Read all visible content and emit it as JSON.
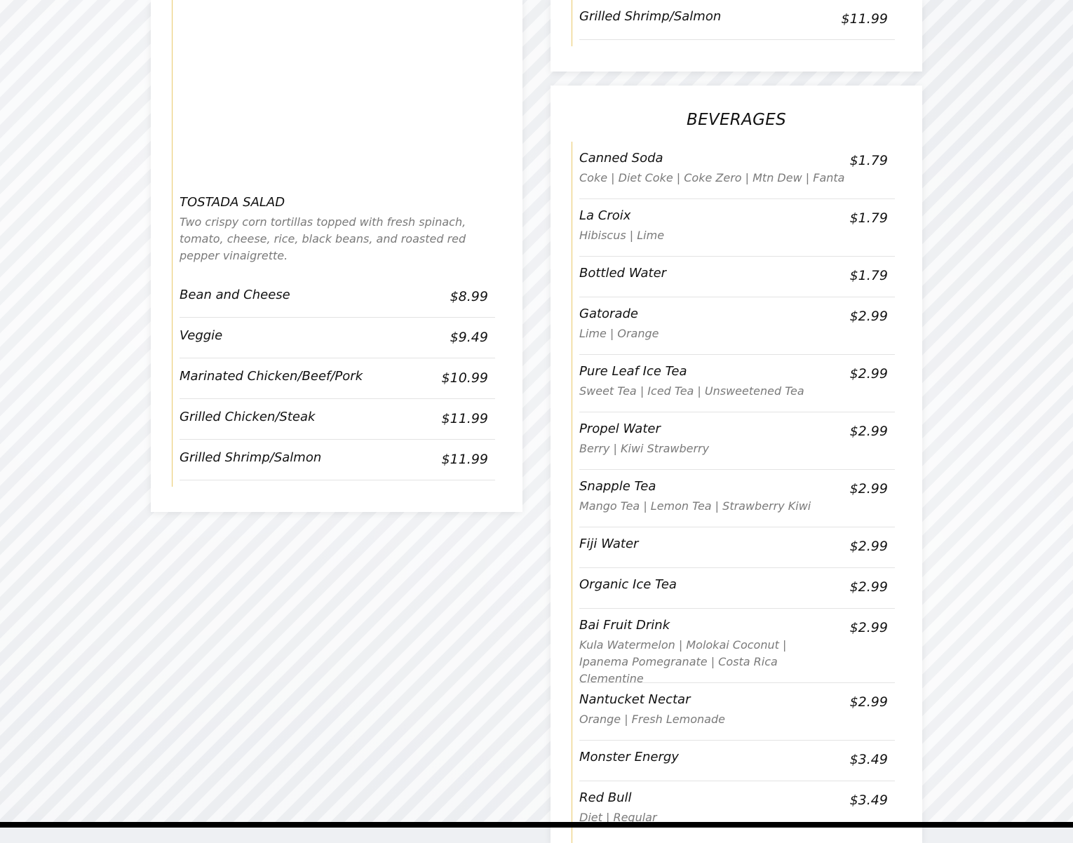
{
  "left_card": {
    "tostada": {
      "title": "TOSTADA SALAD",
      "description": "Two crispy corn tortillas topped with fresh spinach, tomato, cheese, rice, black beans, and roasted red pepper vinaigrette."
    },
    "items": [
      {
        "name": "Bean and Cheese",
        "price": "$8.99"
      },
      {
        "name": "Veggie",
        "price": "$9.49"
      },
      {
        "name": "Marinated Chicken/Beef/Pork",
        "price": "$10.99"
      },
      {
        "name": "Grilled Chicken/Steak",
        "price": "$11.99"
      },
      {
        "name": "Grilled Shrimp/Salmon",
        "price": "$11.99"
      }
    ]
  },
  "right_top_card": {
    "items": [
      {
        "name": "Grilled Shrimp/Salmon",
        "price": "$11.99"
      }
    ]
  },
  "beverages": {
    "title": "BEVERAGES",
    "items": [
      {
        "name": "Canned Soda",
        "desc": "Coke | Diet Coke | Coke Zero | Mtn Dew | Fanta",
        "price": "$1.79"
      },
      {
        "name": "La Croix",
        "desc": "Hibiscus | Lime",
        "price": "$1.79"
      },
      {
        "name": "Bottled Water",
        "desc": "",
        "price": "$1.79"
      },
      {
        "name": "Gatorade",
        "desc": "Lime | Orange",
        "price": "$2.99"
      },
      {
        "name": "Pure Leaf Ice Tea",
        "desc": "Sweet Tea | Iced Tea | Unsweetened Tea",
        "price": "$2.99"
      },
      {
        "name": "Propel Water",
        "desc": "Berry | Kiwi Strawberry",
        "price": "$2.99"
      },
      {
        "name": "Snapple Tea",
        "desc": "Mango Tea | Lemon Tea | Strawberry Kiwi",
        "price": "$2.99"
      },
      {
        "name": "Fiji Water",
        "desc": "",
        "price": "$2.99"
      },
      {
        "name": "Organic Ice Tea",
        "desc": "",
        "price": "$2.99"
      },
      {
        "name": "Bai Fruit Drink",
        "desc": "Kula Watermelon | Molokai Coconut | Ipanema Pomegranate | Costa Rica Clementine",
        "price": "$2.99"
      },
      {
        "name": "Nantucket Nectar",
        "desc": "Orange | Fresh Lemonade",
        "price": "$2.99"
      },
      {
        "name": "Monster Energy",
        "desc": "",
        "price": "$3.49"
      },
      {
        "name": "Red Bull",
        "desc": "Diet | Regular",
        "price": "$3.49"
      }
    ]
  },
  "colors": {
    "accent_line": "#e9c96a",
    "card_bg": "#ffffff",
    "desc_text": "#7a7a7a"
  }
}
